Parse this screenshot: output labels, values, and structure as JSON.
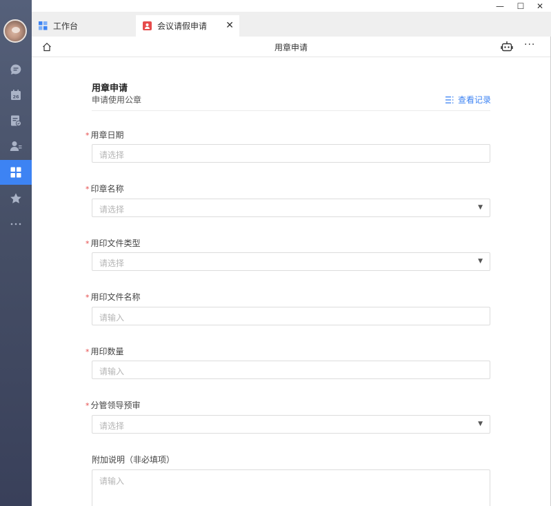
{
  "window": {
    "minimize": "—",
    "maximize": "☐",
    "close": "✕"
  },
  "tabs": [
    {
      "label": "工作台"
    },
    {
      "label": "会议请假申请"
    }
  ],
  "page": {
    "title": "用章申请"
  },
  "form": {
    "title": "用章申请",
    "subtitle": "申请使用公章",
    "history_link": "查看记录",
    "required_mark": "*",
    "fields": [
      {
        "label": "用章日期",
        "placeholder": "请选择"
      },
      {
        "label": "印章名称",
        "placeholder": "请选择"
      },
      {
        "label": "用印文件类型",
        "placeholder": "请选择"
      },
      {
        "label": "用印文件名称",
        "placeholder": "请输入"
      },
      {
        "label": "用印数量",
        "placeholder": "请输入"
      },
      {
        "label": "分管领导预审",
        "placeholder": "请选择"
      }
    ],
    "optional_field": {
      "label": "附加说明（非必填项）",
      "placeholder": "请输入"
    },
    "dropdown_arrow": "▼"
  },
  "colors": {
    "accent": "#3d83f3",
    "required": "#e64b4b",
    "sidebar": "#464f66"
  }
}
